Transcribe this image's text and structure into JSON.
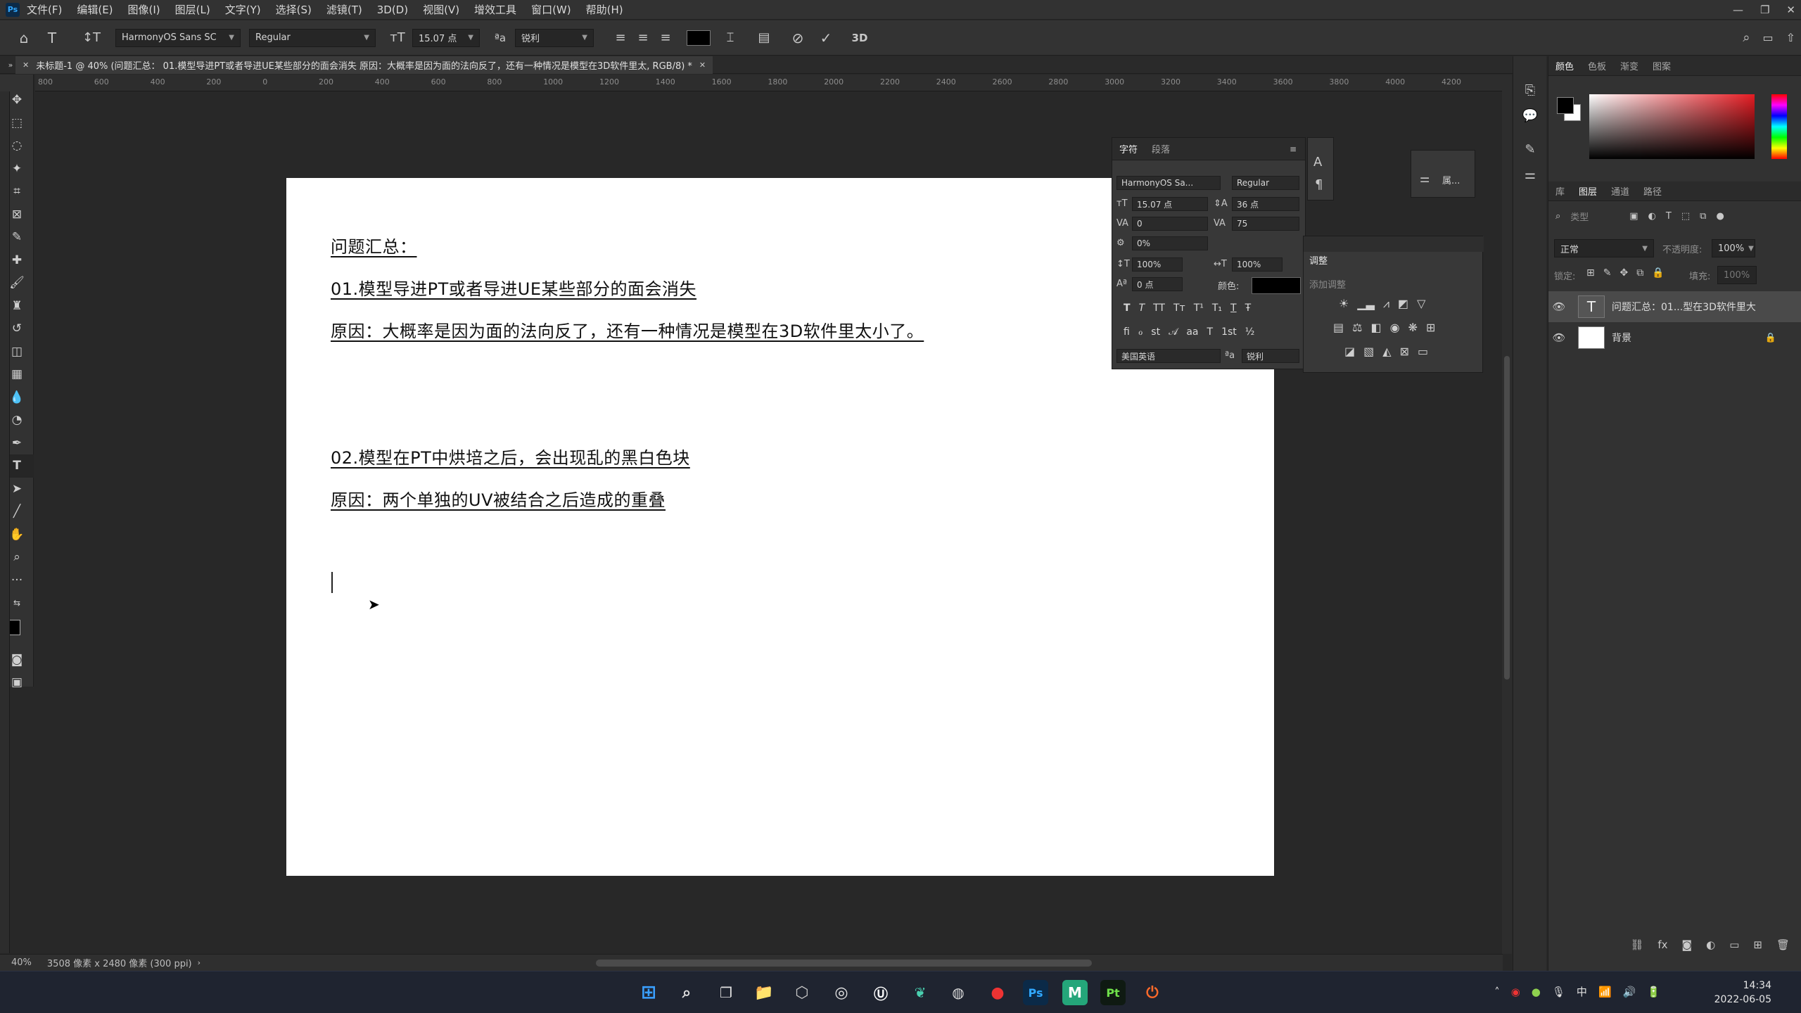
{
  "app": {
    "logo_text": "Ps",
    "menu": [
      "文件(F)",
      "编辑(E)",
      "图像(I)",
      "图层(L)",
      "文字(Y)",
      "选择(S)",
      "滤镜(T)",
      "3D(D)",
      "视图(V)",
      "增效工具",
      "窗口(W)",
      "帮助(H)"
    ]
  },
  "options_bar": {
    "font_family": "HarmonyOS Sans SC",
    "font_style": "Regular",
    "font_size": "15.07 点",
    "anti_alias": "锐利",
    "three_d_label": "3D"
  },
  "document_tab": {
    "title": "未标题-1 @ 40% (问题汇总： 01.模型导进PT或者导进UE某些部分的面会消失 原因：大概率是因为面的法向反了，还有一种情况是模型在3D软件里太, RGB/8) *"
  },
  "ruler_labels": [
    "800",
    "600",
    "400",
    "200",
    "0",
    "200",
    "400",
    "600",
    "800",
    "1000",
    "1200",
    "1400",
    "1600",
    "1800",
    "2000",
    "2200",
    "2400",
    "2600",
    "2800",
    "3000",
    "3200",
    "3400",
    "3600",
    "3800",
    "4000",
    "4200"
  ],
  "canvas_text": {
    "line1": "问题汇总：",
    "line2": "01.模型导进PT或者导进UE某些部分的面会消失",
    "line3": "原因：大概率是因为面的法向反了，还有一种情况是模型在3D软件里太小了。",
    "line4": "02.模型在PT中烘培之后，会出现乱的黑白色块",
    "line5": "原因：两个单独的UV被结合之后造成的重叠"
  },
  "status_bar": {
    "zoom": "40%",
    "doc_size": "3508 像素 x 2480 像素 (300 ppi)"
  },
  "color_panel": {
    "tabs": [
      "颜色",
      "色板",
      "渐变",
      "图案"
    ],
    "accent": "#e51c23"
  },
  "layers_panel": {
    "tabs": [
      "库",
      "图层",
      "通道",
      "路径"
    ],
    "search_placeholder": "类型",
    "blend_mode": "正常",
    "opacity_label": "不透明度:",
    "opacity_value": "100%",
    "lock_label": "锁定:",
    "fill_label": "填充:",
    "fill_value": "100%",
    "layers": [
      {
        "name": "问题汇总：01...型在3D软件里大",
        "type": "text"
      },
      {
        "name": "背景",
        "type": "background"
      }
    ]
  },
  "character_panel": {
    "tabs": [
      "字符",
      "段落"
    ],
    "font_family": "HarmonyOS Sa...",
    "font_style": "Regular",
    "size": "15.07 点",
    "leading": "36 点",
    "kerning": "0",
    "tracking": "75",
    "tsume": "0%",
    "vscale": "100%",
    "hscale": "100%",
    "baseline": "0 点",
    "color_label": "颜色:",
    "language": "美国英语",
    "anti_alias": "锐利",
    "style_buttons": [
      "T",
      "T",
      "TT",
      "Tт",
      "T¹",
      "T₁",
      "T",
      "Ŧ"
    ],
    "opentype_buttons": [
      "ﬁ",
      "ℴ",
      "st",
      "𝒜",
      "aa",
      "T",
      "1st",
      "½"
    ]
  },
  "adjustments_panel": {
    "title": "调整",
    "subtitle": "添加调整"
  },
  "properties_panel": {
    "label": "属..."
  },
  "taskbar": {
    "time": "14:34",
    "date": "2022-06-05",
    "ime": "中",
    "apps": [
      "Ps",
      "M",
      "Pt"
    ]
  }
}
